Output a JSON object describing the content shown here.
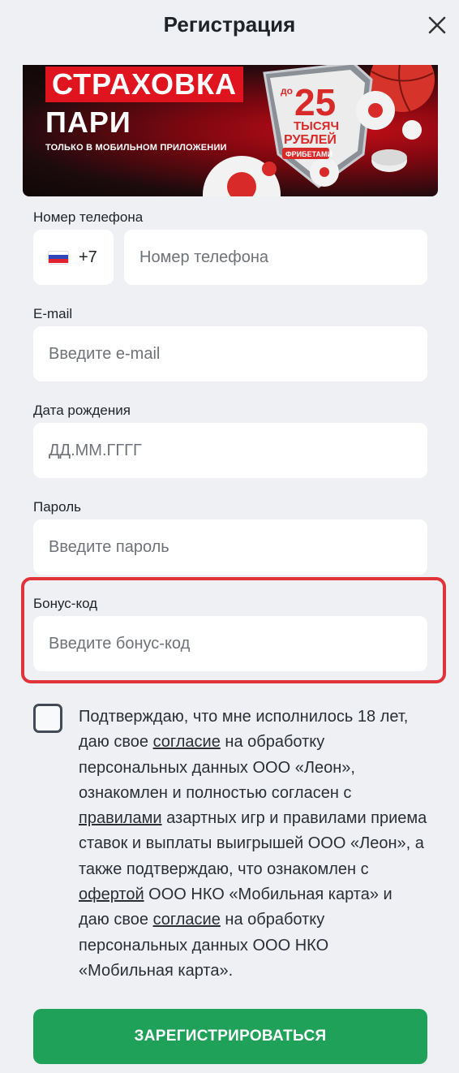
{
  "header": {
    "title": "Регистрация"
  },
  "banner": {
    "headline_1": "СТРАХОВКА",
    "headline_2": "ПАРИ",
    "subline": "ТОЛЬКО В МОБИЛЬНОМ ПРИЛОЖЕНИИ",
    "badge_prefix": "до",
    "badge_amount": "25",
    "badge_unit_1": "ТЫСЯЧ",
    "badge_unit_2": "РУБЛЕЙ",
    "badge_tag": "ФРИБЕТАМИ"
  },
  "form": {
    "phone": {
      "label": "Номер телефона",
      "country_code": "+7",
      "placeholder": "Номер телефона"
    },
    "email": {
      "label": "E-mail",
      "placeholder": "Введите e-mail"
    },
    "birthdate": {
      "label": "Дата рождения",
      "placeholder": "ДД.ММ.ГГГГ"
    },
    "password": {
      "label": "Пароль",
      "placeholder": "Введите пароль"
    },
    "bonus": {
      "label": "Бонус-код",
      "placeholder": "Введите бонус-код"
    }
  },
  "consent": {
    "t1": "Подтверждаю, что мне исполнилось 18 лет, даю свое ",
    "link1": "согласие",
    "t2": " на обработку персональных данных ООО «Леон», ознакомлен и полностью согласен с ",
    "link2": "правилами",
    "t3": " азартных игр и правилами приема ставок и выплаты выигрышей ООО «Леон», а также подтверждаю, что ознакомлен с ",
    "link3": "офертой",
    "t4": " ООО НКО «Мобильная карта» и даю свое ",
    "link4": "согласие",
    "t5": " на обработку персональных данных ООО НКО «Мобильная карта»."
  },
  "submit_label": "ЗАРЕГИСТРИРОВАТЬСЯ",
  "colors": {
    "accent": "#1fa159",
    "highlight": "#e0333a",
    "background": "#eef0f3"
  }
}
